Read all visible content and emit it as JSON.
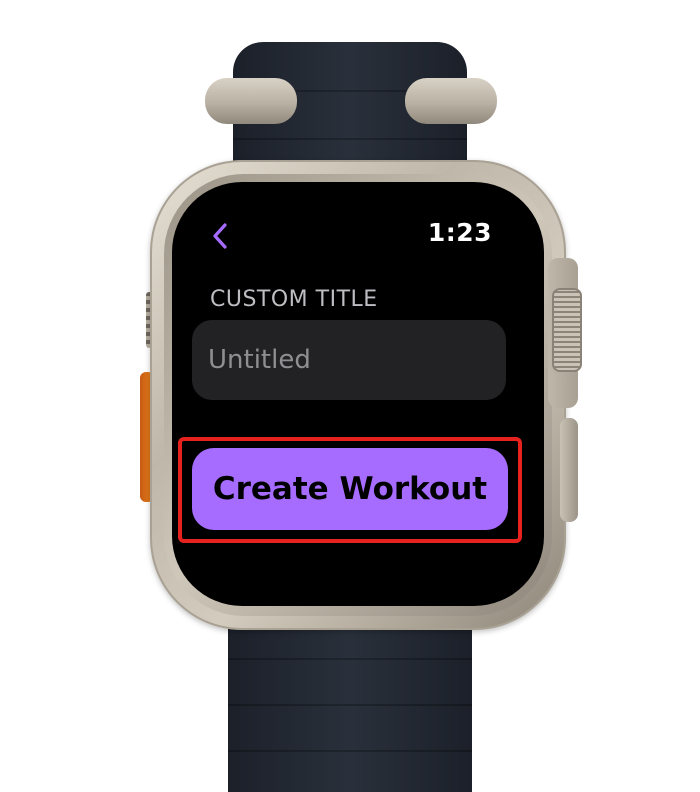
{
  "status_bar": {
    "time": "1:23"
  },
  "navigation": {
    "back_icon": "chevron-left-icon"
  },
  "form": {
    "section_label": "CUSTOM TITLE",
    "title_placeholder": "Untitled"
  },
  "actions": {
    "create_label": "Create Workout"
  },
  "colors": {
    "accent": "#a66cff",
    "highlight": "#e6221f",
    "field_background": "#222224",
    "screen_background": "#000000"
  }
}
